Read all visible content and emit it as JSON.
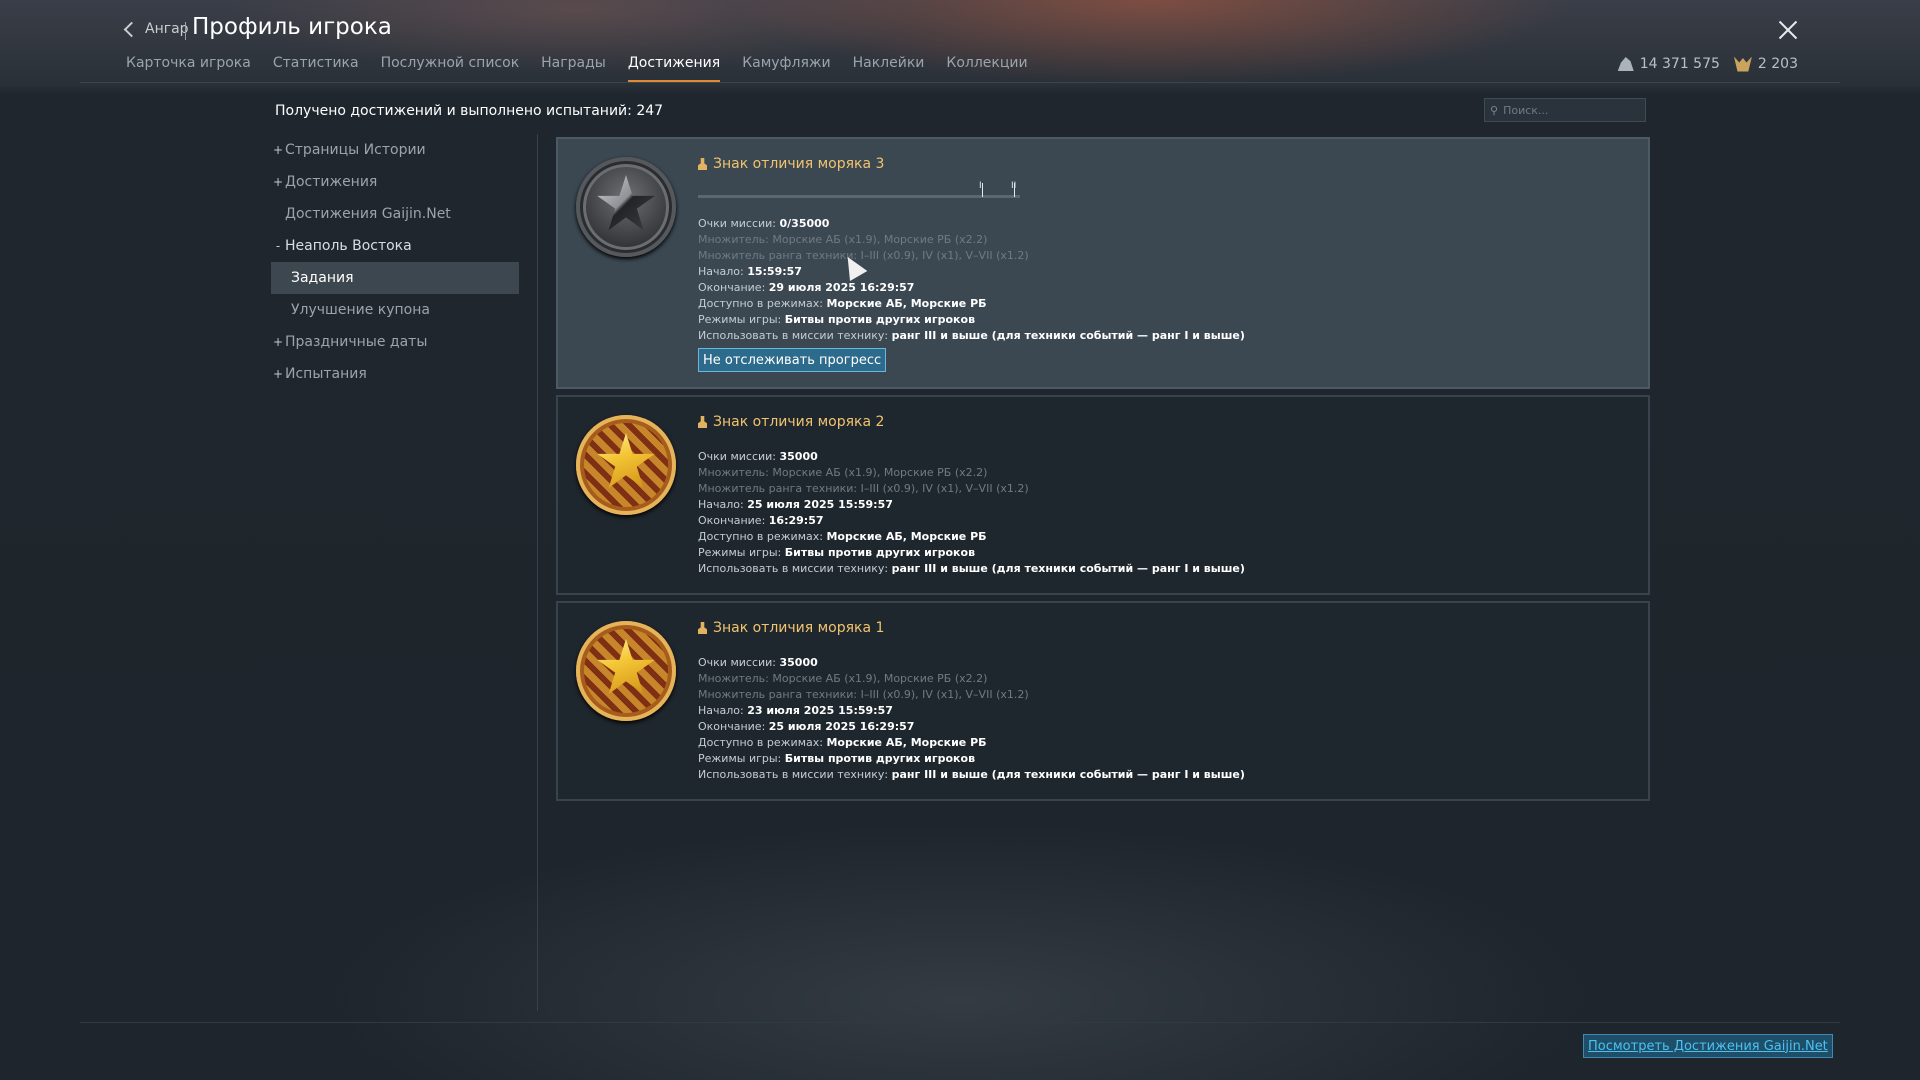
{
  "header": {
    "back_label": "Ангар",
    "title": "Профиль игрока",
    "tabs": [
      {
        "label": "Карточка игрока"
      },
      {
        "label": "Статистика"
      },
      {
        "label": "Послужной список"
      },
      {
        "label": "Награды"
      },
      {
        "label": "Достижения",
        "active": true
      },
      {
        "label": "Камуфляжи"
      },
      {
        "label": "Наклейки"
      },
      {
        "label": "Коллекции"
      }
    ],
    "currency": {
      "silver": "14 371 575",
      "gold": "2 203"
    }
  },
  "summary": "Получено достижений и выполнено испытаний: 247",
  "search": {
    "placeholder": "Поиск..."
  },
  "sidebar": {
    "items": [
      {
        "marker": "+",
        "label": "Страницы Истории"
      },
      {
        "marker": "+",
        "label": "Достижения"
      },
      {
        "marker": "",
        "label": "Достижения Gaijin.Net"
      },
      {
        "marker": "-",
        "label": "Неаполь Востока"
      },
      {
        "marker": "",
        "label": "Задания"
      },
      {
        "marker": "",
        "label": "Улучшение купона"
      },
      {
        "marker": "+",
        "label": "Праздничные даты"
      },
      {
        "marker": "+",
        "label": "Испытания"
      }
    ]
  },
  "labels": {
    "points": "Очки миссии:",
    "mult": "Множитель:",
    "rank_mult": "Множитель ранга техники:",
    "start": "Начало:",
    "end": "Окончание:",
    "modes": "Доступно в режимах:",
    "game_modes": "Режимы игры:",
    "vehicles": "Использовать в миссии технику:"
  },
  "cards": [
    {
      "title": "Знак отличия моряка 3",
      "progress": 0,
      "progress_marks": [
        "I",
        "II"
      ],
      "points": "0/35000",
      "mult": "Морские АБ (x1.9), Морские РБ (x2.2)",
      "rank_mult": "I–III (x0.9), IV (x1), V–VII (x1.2)",
      "start": "15:59:57",
      "end": "29 июля 2025 16:29:57",
      "modes": "Морские АБ, Морские РБ",
      "game_modes": "Битвы против других игроков",
      "vehicles": "ранг III и выше (для техники событий — ранг I и выше)",
      "button": "Не отслеживать прогресс"
    },
    {
      "title": "Знак отличия моряка 2",
      "points": "35000",
      "mult": "Морские АБ (x1.9), Морские РБ (x2.2)",
      "rank_mult": "I–III (x0.9), IV (x1), V–VII (x1.2)",
      "start": "25 июля 2025 15:59:57",
      "end": "16:29:57",
      "modes": "Морские АБ, Морские РБ",
      "game_modes": "Битвы против других игроков",
      "vehicles": "ранг III и выше (для техники событий — ранг I и выше)"
    },
    {
      "title": "Знак отличия моряка 1",
      "points": "35000",
      "mult": "Морские АБ (x1.9), Морские РБ (x2.2)",
      "rank_mult": "I–III (x0.9), IV (x1), V–VII (x1.2)",
      "start": "23 июля 2025 15:59:57",
      "end": "25 июля 2025 16:29:57",
      "modes": "Морские АБ, Морские РБ",
      "game_modes": "Битвы против других игроков",
      "vehicles": "ранг III и выше (для техники событий — ранг I и выше)"
    }
  ],
  "footer": {
    "link": "Посмотреть Достижения Gaijin.Net"
  }
}
